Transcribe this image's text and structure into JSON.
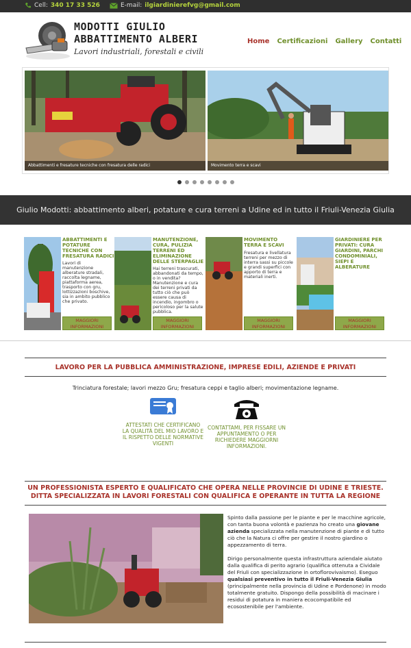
{
  "topbar": {
    "phone_label": "Cell:",
    "phone": "340 17 33 526",
    "email_label": "E-mail:",
    "email": "ilgiardinierefvg@gmail.com"
  },
  "header": {
    "logo_line1": "MODOTTI GIULIO",
    "logo_line2": "ABBATTIMENTO ALBERI",
    "logo_tagline": "Lavori industriali, forestali e civili"
  },
  "nav": {
    "items": [
      "Home",
      "Certificazioni",
      "Gallery",
      "Contatti"
    ]
  },
  "slider": {
    "captions": [
      "Abbattimenti e fresature tecniche con fresatura delle radici",
      "Movimento terra e scavi"
    ],
    "dot_count": 8,
    "active_dot": 1
  },
  "band": {
    "text": "Giulio Modotti: abbattimento alberi, potature e cura terreni a Udine ed in tutto il Friuli-Venezia Giulia"
  },
  "services": [
    {
      "title": "ABBATTIMENTI E POTATURE TECNICHE CON FRESATURA RADICI",
      "desc": "Lavori di manutenzione alberature stradali, raccolta legname, piattaforma aerea, trasporto con gru, lottizzazioni boschive, sia in ambito pubblico che privato.",
      "button": "MAGGIORI INFORMAZIONI"
    },
    {
      "title": "MANUTENZIONE, CURA, PULIZIA TERRENI ED ELIMINAZIONE DELLE STERPAGLIE",
      "desc": "Hai terreni trascurati, abbandonati da tempo, o in vendita? Manutenzione e cura dei terreni privati da tutto ciò che può essere causa di incendio, ingombro o pericoloso per la salute pubblica.",
      "button": "MAGGIORI INFORMAZIONI"
    },
    {
      "title": "MOVIMENTO TERRA E SCAVI",
      "desc": "Fresatura e livellatura terreni per mezzo di interra sassi su piccole e grandi superfici con apporto di terra e materiali inerti.",
      "button": "MAGGIORI INFORMAZIONI"
    },
    {
      "title": "GIARDINIERE PER PRIVATI: CURA GIARDINI, PARCHI CONDOMINIALI, SIEPI E ALBERATURE",
      "desc": "",
      "button": "MAGGIORI INFORMAZIONI"
    }
  ],
  "section2": {
    "heading": "LAVORO PER LA PUBBLICA AMMINISTRAZIONE, IMPRESE EDILI, AZIENDE E PRIVATI",
    "lead": "Trinciatura forestale; lavori mezzo Gru; fresatura ceppi e taglio alberi; movimentazione legname.",
    "features": [
      {
        "icon": "certificate-icon",
        "text": "ATTESTATI CHE CERTIFICANO LA QUALITÀ DEL MIO LAVORO E IL RISPETTO DELLE NORMATIVE VIGENTI"
      },
      {
        "icon": "telephone-icon",
        "text": "CONTATTAMI, PER FISSARE UN APPUNTAMENTO O PER RICHIEDERE MAGGIORNI INFORMAZIONI."
      }
    ]
  },
  "section3": {
    "heading_line1": "UN PROFESSIONISTA ESPERTO E QUALIFICATO CHE OPERA NELLE PROVINCIE DI UDINE E TRIESTE.",
    "heading_line2": "DITTA SPECIALIZZATA IN LAVORI FORESTALI CON QUALIFICA E OPERANTE IN TUTTA LA REGIONE",
    "p1_a": "Spinto dalla passione per le piante e per le macchine agricole, con tanta buona volontà e pazienza ho creato una ",
    "p1_b": "giovane azienda",
    "p1_c": " specializzata nella manutenzione di piante e di tutto ciò che la Natura ci offre per gestire il nostro giardino o appezzamento di terra.",
    "p2_a": "Dirigo personalmente questa infrastruttura aziendale aiutato dalla qualifica di perito agrario (qualifica ottenuta a Cividale del Friuli con specializzazione in ortoflorovivaismo). Eseguo ",
    "p2_b": "qualsiasi preventivo in tutto il Friuli-Venezia Giulia",
    "p2_c": " (principalmente nella provincia di Udine e Pordenone) in modo totalmente gratuito. Dispongo della possibilità di macinare i residui di potatura in maniera ecocompatibile ed ecosostenibile per l'ambiente."
  },
  "colors": {
    "accent_green": "#6f8f2b",
    "accent_red": "#a8322a",
    "topbar_bg": "#2f2f2f",
    "band_bg": "#333333"
  }
}
